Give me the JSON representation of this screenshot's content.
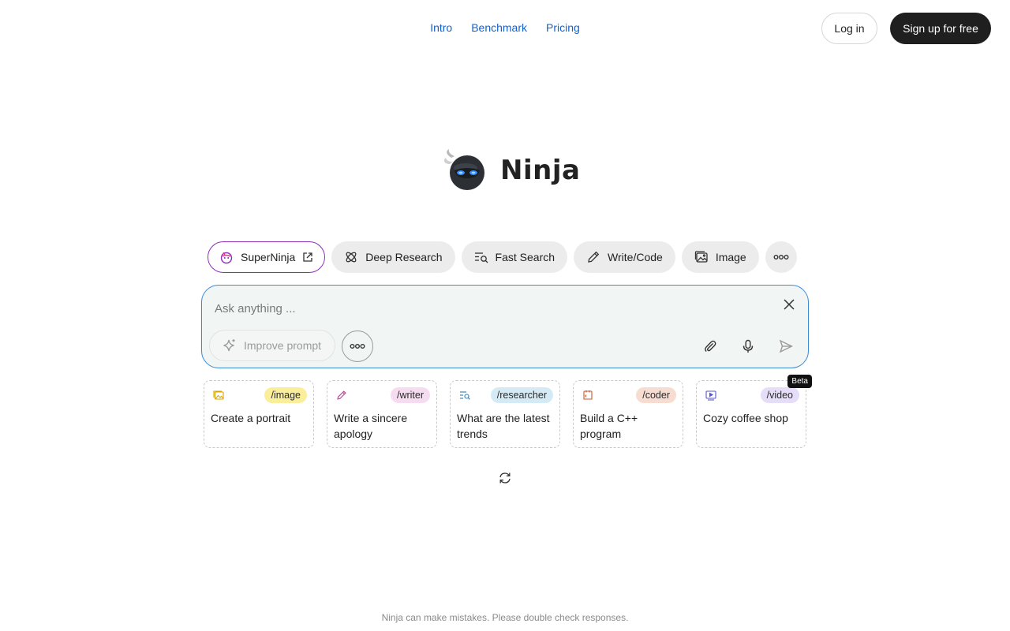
{
  "nav": {
    "links": [
      "Intro",
      "Benchmark",
      "Pricing"
    ],
    "login_label": "Log in",
    "signup_label": "Sign up for free"
  },
  "brand": {
    "name": "Ninja"
  },
  "modes": [
    {
      "label": "SuperNinja",
      "icon": "superninja-icon",
      "external": true
    },
    {
      "label": "Deep Research",
      "icon": "atom-icon"
    },
    {
      "label": "Fast Search",
      "icon": "search-list-icon"
    },
    {
      "label": "Write/Code",
      "icon": "pencil-icon"
    },
    {
      "label": "Image",
      "icon": "image-icon"
    }
  ],
  "input": {
    "placeholder": "Ask anything ...",
    "improve_label": "Improve prompt"
  },
  "cards": [
    {
      "tag": "/image",
      "text": "Create a portrait",
      "tag_color": "#fbee9a",
      "icon": "image-icon"
    },
    {
      "tag": "/writer",
      "text": "Write a sincere apology",
      "tag_color": "#f6dcf0",
      "icon": "pencil-icon"
    },
    {
      "tag": "/researcher",
      "text": "What are the latest trends",
      "tag_color": "#d4ebf6",
      "icon": "search-list-icon"
    },
    {
      "tag": "/coder",
      "text": "Build a C++ program",
      "tag_color": "#f7dcd2",
      "icon": "code-icon"
    },
    {
      "tag": "/video",
      "text": "Cozy coffee shop",
      "tag_color": "#e6def8",
      "icon": "video-icon",
      "badge": "Beta"
    }
  ],
  "footer": {
    "disclaimer": "Ninja can make mistakes. Please double check responses."
  },
  "colors": {
    "link": "#1062d0",
    "dark_button": "#1f1f1f",
    "input_border": "#3b8ad8",
    "superninja_border": "#8b2fb8"
  }
}
